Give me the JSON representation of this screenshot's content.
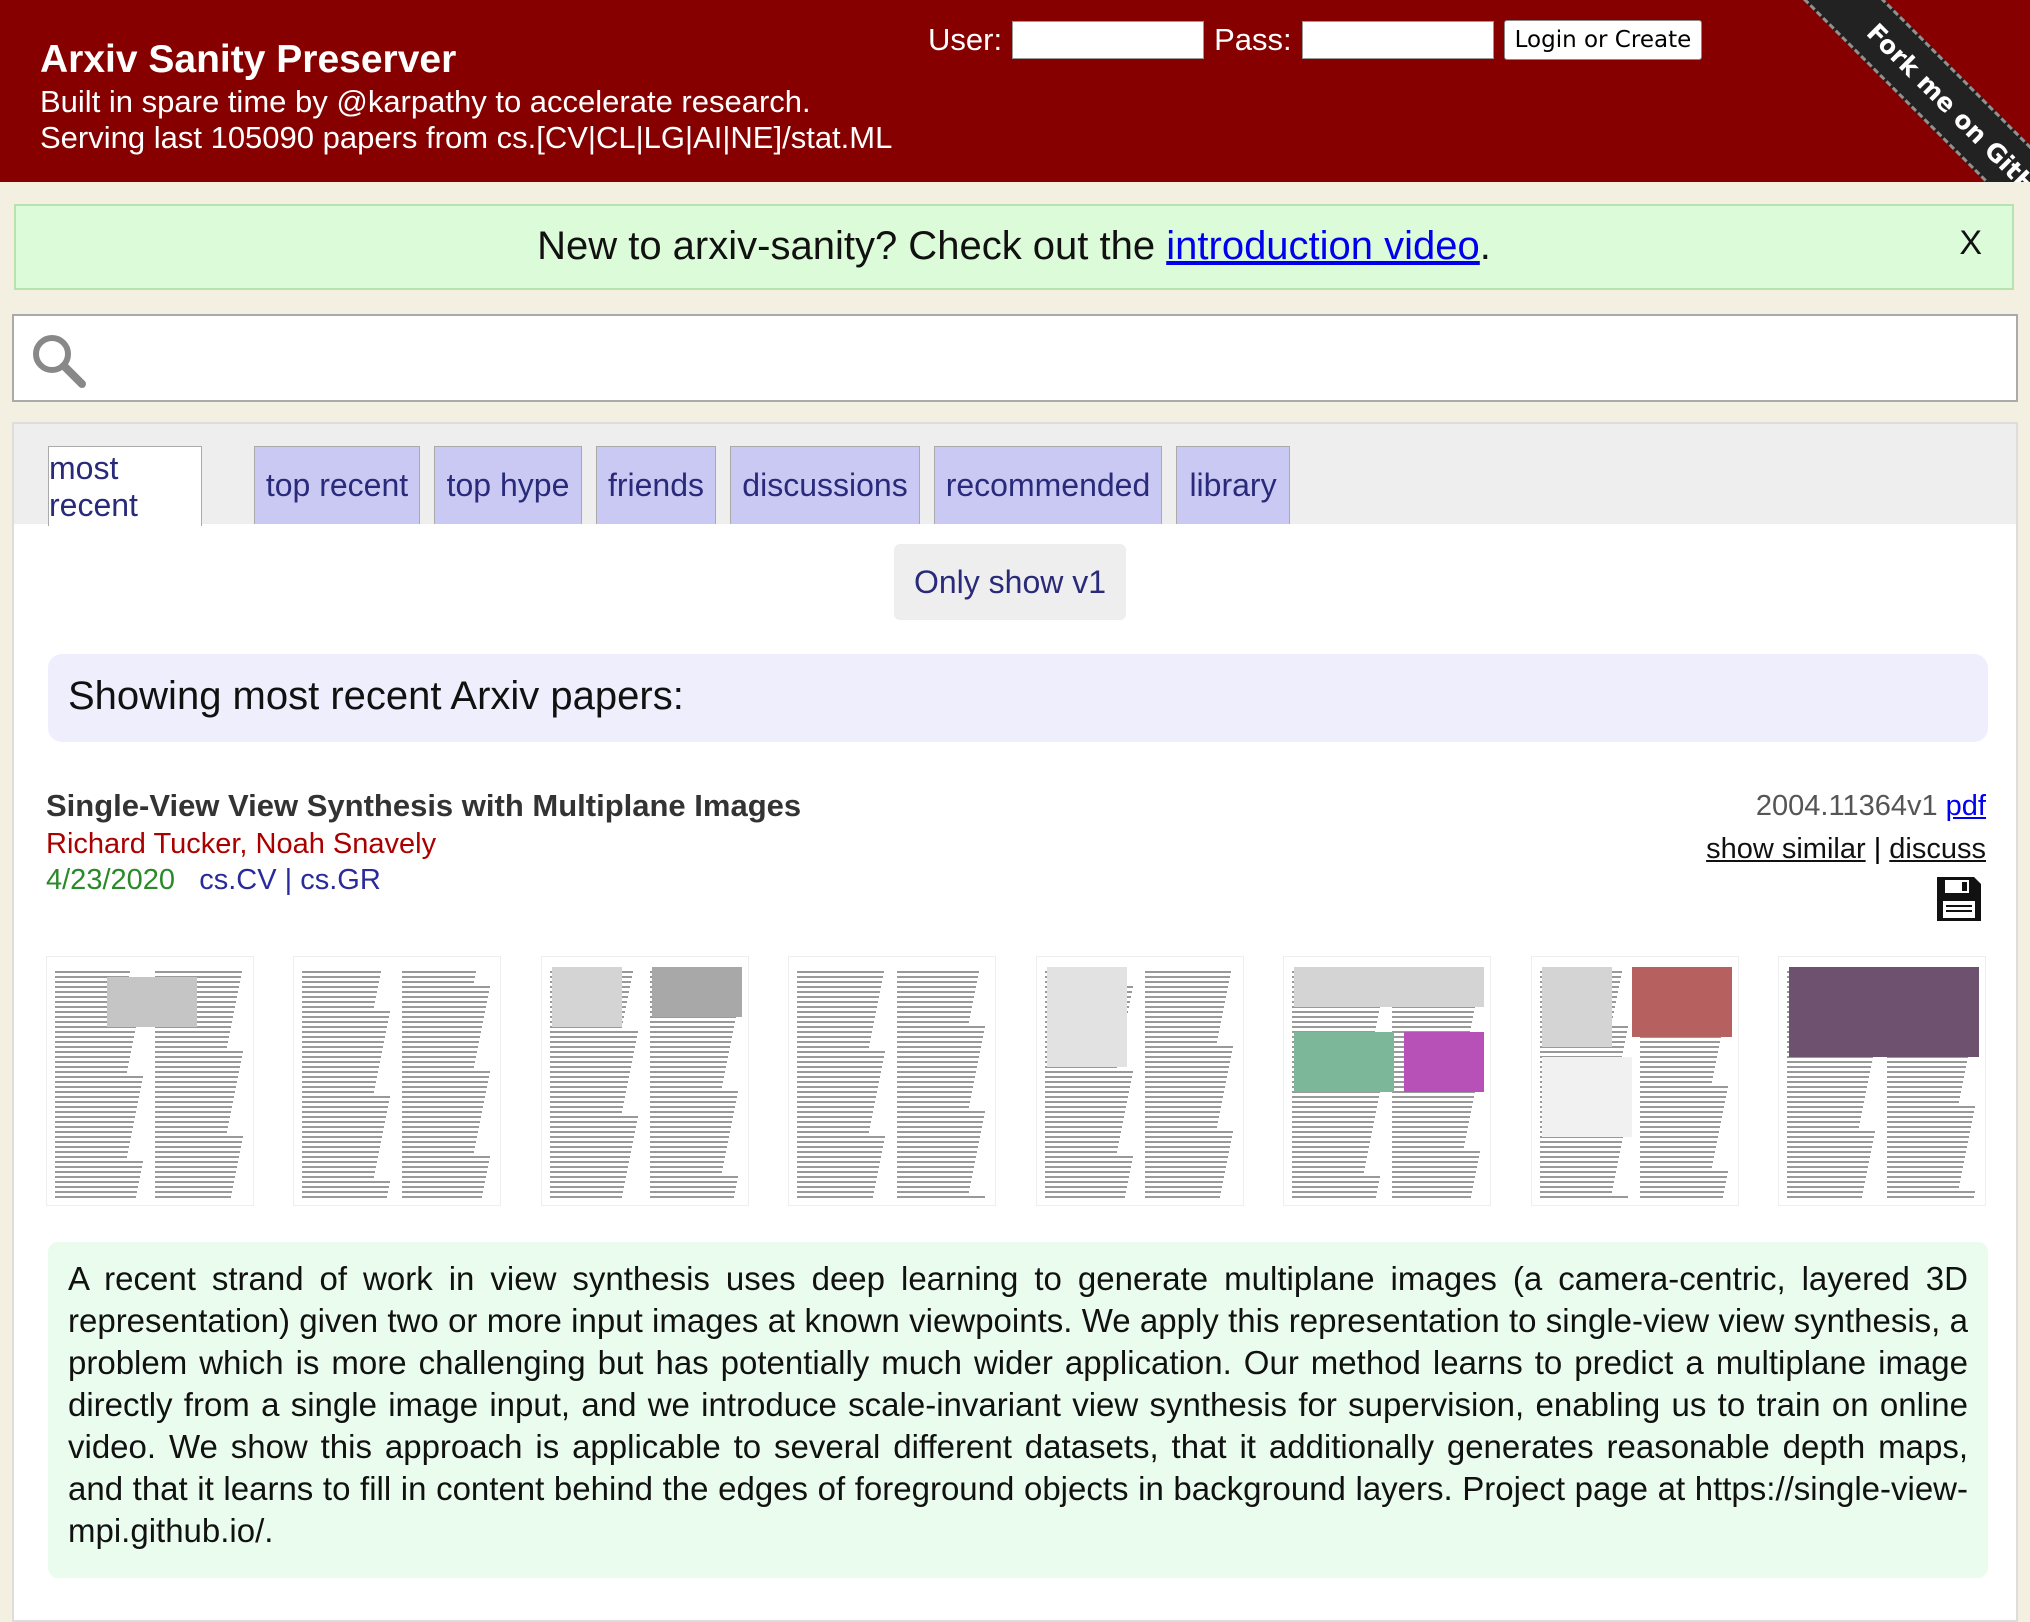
{
  "header": {
    "site_title": "Arxiv Sanity Preserver",
    "tagline_line1": "Built in spare time by @karpathy to accelerate research.",
    "tagline_line2": "Serving last 105090 papers from cs.[CV|CL|LG|AI|NE]/stat.ML",
    "login": {
      "user_label": "User:",
      "pass_label": "Pass:",
      "submit_label": "Login or Create",
      "user_value": "",
      "pass_value": ""
    },
    "fork_ribbon": "Fork me on GitHub"
  },
  "intro_banner": {
    "text_before": "New to arxiv-sanity? Check out the ",
    "link_text": "introduction video",
    "text_after": ".",
    "close_label": "X"
  },
  "search": {
    "value": "",
    "placeholder": ""
  },
  "tabs": [
    {
      "label": "most recent",
      "active": true
    },
    {
      "label": "top recent",
      "active": false
    },
    {
      "label": "top hype",
      "active": false
    },
    {
      "label": "friends",
      "active": false
    },
    {
      "label": "discussions",
      "active": false
    },
    {
      "label": "recommended",
      "active": false
    },
    {
      "label": "library",
      "active": false
    }
  ],
  "v1_toggle": "Only show v1",
  "showing_heading": "Showing most recent Arxiv papers:",
  "paper": {
    "title": "Single-View View Synthesis with Multiplane Images",
    "authors": "Richard Tucker, Noah Snavely",
    "date": "4/23/2020",
    "categories": [
      "cs.CV",
      "cs.GR"
    ],
    "category_separator": "|",
    "arxiv_id": "2004.11364v1",
    "pdf_label": "pdf",
    "show_similar_label": "show similar",
    "discuss_label": "discuss",
    "link_separator": "|",
    "thumbnail_pages": 8,
    "abstract": "A recent strand of work in view synthesis uses deep learning to generate multiplane images (a camera-centric, layered 3D representation) given two or more input images at known viewpoints. We apply this representation to single-view view synthesis, a problem which is more challenging but has potentially much wider application. Our method learns to predict a multiplane image directly from a single image input, and we introduce scale-invariant view synthesis for supervision, enabling us to train on online video. We show this approach is applicable to several different datasets, that it additionally generates reasonable depth maps, and that it learns to fill in content behind the edges of foreground objects in background layers. Project page at https://single-view-mpi.github.io/."
  },
  "icons": {
    "search": "search-icon",
    "save": "floppy-disk-icon"
  },
  "colors": {
    "header_bg": "#870000",
    "page_bg": "#f3efe1",
    "banner_bg": "#dcfbd8",
    "tab_bg": "#c9c9f3",
    "authors": "#aa0000",
    "date": "#2a8a2a",
    "abstract_bg": "#eafced"
  }
}
